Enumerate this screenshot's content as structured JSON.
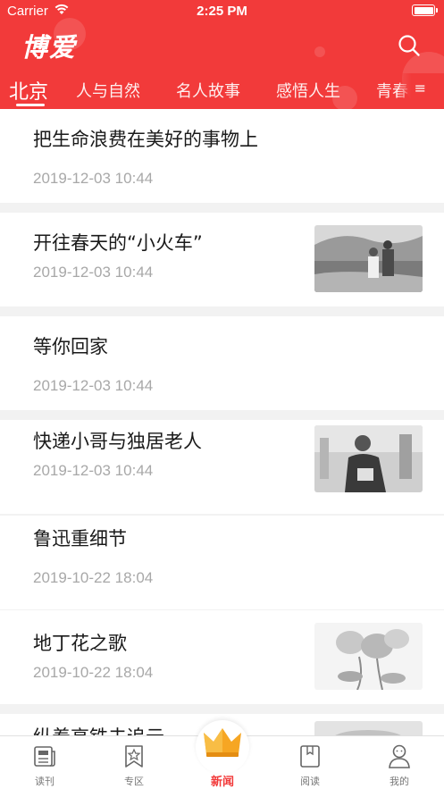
{
  "status": {
    "carrier": "Carrier",
    "time": "2:25 PM"
  },
  "header": {
    "logo": "博爱",
    "colors": {
      "brand": "#f23a3a"
    }
  },
  "tabs": [
    "北京",
    "人与自然",
    "名人故事",
    "感悟人生",
    "青春"
  ],
  "tabs_more": "≡",
  "articles": [
    {
      "title": "把生命浪费在美好的事物上",
      "date": "2019-12-03 10:44",
      "thumb": false
    },
    {
      "title": "开往春天的“小火车”",
      "date": "2019-12-03 10:44",
      "thumb": true
    },
    {
      "title": "等你回家",
      "date": "2019-12-03 10:44",
      "thumb": false
    },
    {
      "title": "快递小哥与独居老人",
      "date": "2019-12-03 10:44",
      "thumb": true
    },
    {
      "title": "鲁迅重细节",
      "date": "2019-10-22 18:04",
      "thumb": false
    },
    {
      "title": "地丁花之歌",
      "date": "2019-10-22 18:04",
      "thumb": true
    },
    {
      "title": "纵着高铁去追云",
      "date": "",
      "thumb": true
    }
  ],
  "tabbar": {
    "items": [
      {
        "label": "读刊",
        "icon": "newspaper-icon"
      },
      {
        "label": "专区",
        "icon": "star-bookmark-icon"
      },
      {
        "label": "新闻",
        "icon": "crown-icon"
      },
      {
        "label": "阅读",
        "icon": "book-icon"
      },
      {
        "label": "我的",
        "icon": "person-icon"
      }
    ]
  }
}
